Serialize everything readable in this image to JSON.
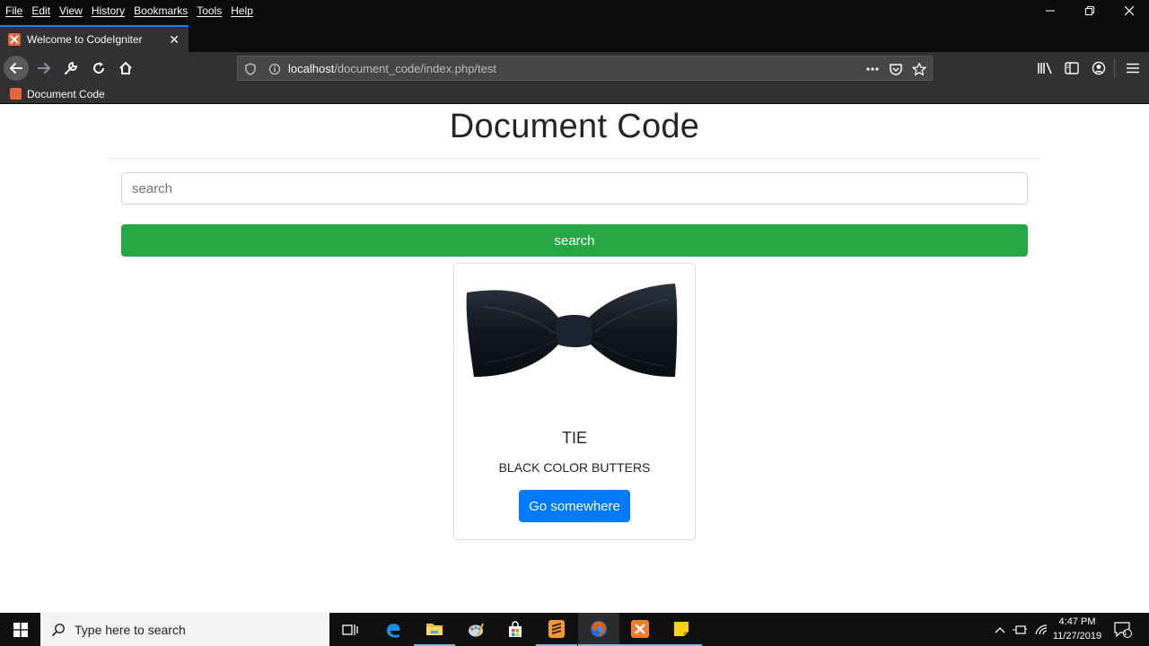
{
  "menubar": {
    "items": [
      "File",
      "Edit",
      "View",
      "History",
      "Bookmarks",
      "Tools",
      "Help"
    ]
  },
  "tab": {
    "title": "Welcome to CodeIgniter"
  },
  "urlbar": {
    "host": "localhost",
    "path": "/document_code/index.php/test"
  },
  "bookmarks": {
    "items": [
      "Document Code"
    ]
  },
  "page": {
    "title": "Document Code",
    "search_placeholder": "search",
    "search_button": "search",
    "card": {
      "title": "TIE",
      "text": "BLACK COLOR BUTTERS",
      "button": "Go somewhere",
      "image_alt": "black bow tie"
    }
  },
  "taskbar": {
    "search_placeholder": "Type here to search",
    "time": "4:47 PM",
    "date": "11/27/2019",
    "notification_count": "1"
  },
  "colors": {
    "accent": "#0a84ff",
    "success": "#28a745",
    "primary": "#007bff",
    "chrome_dark": "#0c0c0d",
    "chrome_toolbar": "#323234"
  }
}
